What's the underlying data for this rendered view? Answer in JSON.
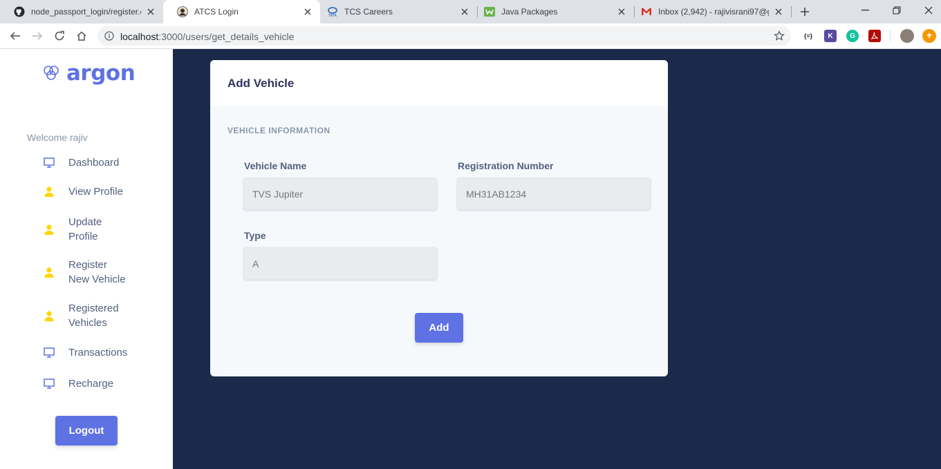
{
  "browser": {
    "tabs": [
      {
        "title": "node_passport_login/register.e",
        "icon": "github-icon"
      },
      {
        "title": "ATCS Login",
        "icon": "avatar-favicon-icon",
        "active": true
      },
      {
        "title": "TCS Careers",
        "icon": "tata-icon"
      },
      {
        "title": "Java Packages",
        "icon": "package-icon"
      },
      {
        "title": "Inbox (2,942) - rajivisrani97@g",
        "icon": "gmail-icon"
      }
    ],
    "url_host": "localhost",
    "url_path": ":3000/users/get_details_vehicle"
  },
  "sidebar": {
    "brand": "argon",
    "welcome": "Welcome rajiv",
    "items": [
      {
        "line1": "Dashboard",
        "line2": "",
        "icon": "monitor-icon"
      },
      {
        "line1": "View Profile",
        "line2": "",
        "icon": "user-icon"
      },
      {
        "line1": "Update",
        "line2": "Profile",
        "icon": "user-icon"
      },
      {
        "line1": "Register",
        "line2": "New Vehicle",
        "icon": "user-icon"
      },
      {
        "line1": "Registered",
        "line2": "Vehicles",
        "icon": "user-icon"
      },
      {
        "line1": "Transactions",
        "line2": "",
        "icon": "monitor-icon"
      },
      {
        "line1": "Recharge",
        "line2": "",
        "icon": "monitor-icon"
      }
    ],
    "logout": "Logout"
  },
  "card": {
    "title": "Add Vehicle",
    "section": "VEHICLE INFORMATION",
    "fields": {
      "vehicle_name": {
        "label": "Vehicle Name",
        "placeholder": "TVS Jupiter"
      },
      "registration_number": {
        "label": "Registration Number",
        "placeholder": "MH31AB1234"
      },
      "type": {
        "label": "Type",
        "placeholder": "A"
      }
    },
    "submit": "Add"
  },
  "colors": {
    "primary": "#5e72e4",
    "page_background": "#1b2a4a",
    "icon_user": "#ffd600",
    "icon_monitor": "#5e72e4"
  }
}
